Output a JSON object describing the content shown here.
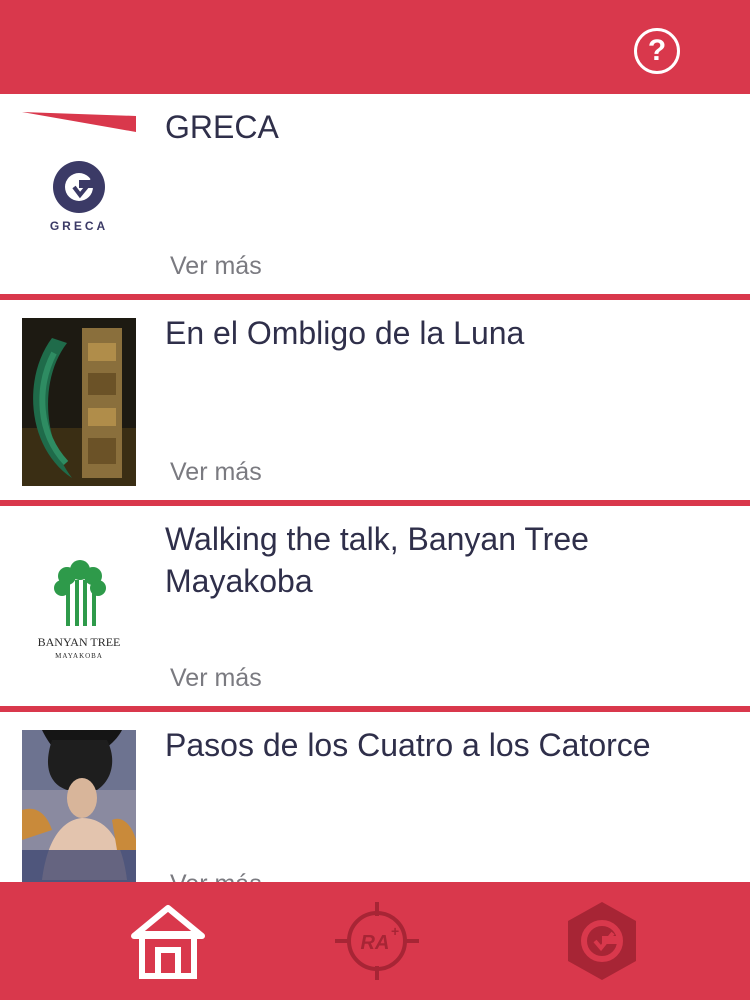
{
  "header": {
    "help_icon": "question-circle-icon"
  },
  "items": [
    {
      "title": "GRECA",
      "more": "Ver más",
      "logo_text": "GRECA"
    },
    {
      "title": "En el Ombligo de la Luna",
      "more": "Ver más"
    },
    {
      "title": "Walking the talk, Banyan Tree Mayakoba",
      "more": "Ver más",
      "logo_line1": "BANYAN TREE",
      "logo_line2": "MAYAKOBA"
    },
    {
      "title": "Pasos de los Cuatro a los Catorce",
      "more": "Ver más"
    }
  ],
  "tabbar": {
    "home_icon": "home-icon",
    "ar_label": "RA",
    "greca_icon": "greca-logo-icon"
  },
  "colors": {
    "accent": "#d9384c",
    "title": "#2f2f4a",
    "muted": "#7a7a80",
    "ar_icon": "#a72535"
  }
}
